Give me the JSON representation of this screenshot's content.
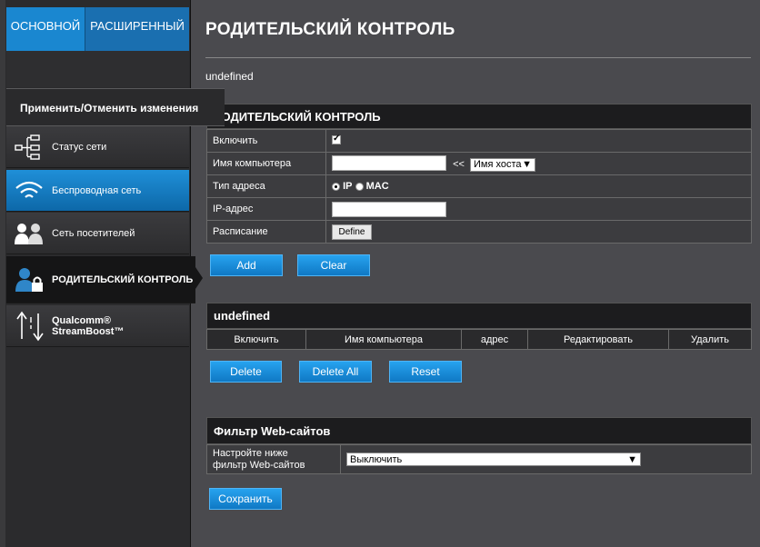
{
  "tabs": {
    "basic": "ОСНОВНОЙ",
    "advanced": "РАСШИРЕННЫЙ"
  },
  "sidebar": {
    "apply_label": "Применить/Отменить изменения",
    "items": [
      {
        "label": "Статус сети",
        "icon": "network-status-icon"
      },
      {
        "label": "Беспроводная сеть",
        "icon": "wifi-icon"
      },
      {
        "label": "Сеть посетителей",
        "icon": "guests-icon"
      },
      {
        "label": "РОДИТЕЛЬСКИЙ КОНТРОЛЬ",
        "icon": "parental-lock-icon"
      },
      {
        "label_line1": "Qualcomm®",
        "label_line2": "StreamBoost™",
        "icon": "streamboost-icon"
      }
    ]
  },
  "page": {
    "title": "РОДИТЕЛЬСКИЙ КОНТРОЛЬ",
    "note": "undefined"
  },
  "parental": {
    "header": "РОДИТЕЛЬСКИЙ КОНТРОЛЬ",
    "enable_label": "Включить",
    "enable_checked": true,
    "computer_label": "Имя компьютера",
    "computer_value": "",
    "arrow": "<<",
    "host_select": "Имя хоста",
    "addr_type_label": "Тип адреса",
    "ip_option": "IP",
    "mac_option": "MAC",
    "addr_type_selected": "IP",
    "ip_label": "IP-адрес",
    "ip_value": "",
    "schedule_label": "Расписание",
    "define_button": "Define",
    "add_button": "Add",
    "clear_button": "Clear"
  },
  "list": {
    "header": "undefined",
    "columns": [
      "Включить",
      "Имя компьютера",
      "адрес",
      "Редактировать",
      "Удалить"
    ],
    "delete_button": "Delete",
    "delete_all_button": "Delete All",
    "reset_button": "Reset"
  },
  "webfilter": {
    "header": "Фильтр Web-сайтов",
    "setup_label_line1": "Настройте ниже",
    "setup_label_line2": "фильтр Web-сайтов",
    "select_value": "Выключить",
    "save_button": "Сохранить"
  },
  "colors": {
    "accent": "#1a87d0",
    "background": "#4a4a4e",
    "sidebar": "#2b2b2d"
  }
}
